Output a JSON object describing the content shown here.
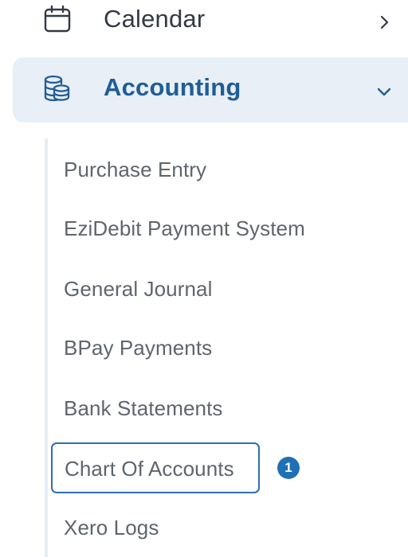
{
  "nav": {
    "calendar": {
      "label": "Calendar",
      "icon": "calendar-icon"
    },
    "accounting": {
      "label": "Accounting",
      "icon": "database-icon",
      "expanded": true,
      "accent_color": "#1f5d98",
      "background_color": "#e9eff7"
    },
    "sub_items": [
      {
        "label": "Purchase Entry"
      },
      {
        "label": "EziDebit Payment System"
      },
      {
        "label": "General Journal"
      },
      {
        "label": "BPay Payments"
      },
      {
        "label": "Bank Statements"
      },
      {
        "label": "Chart Of Accounts",
        "active": true,
        "badge": "1"
      },
      {
        "label": "Xero Logs"
      }
    ]
  }
}
